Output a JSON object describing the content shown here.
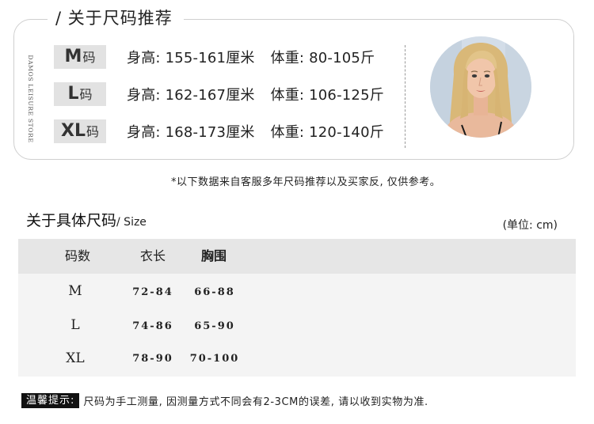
{
  "recommendation": {
    "title": "/ 关于尺码推荐",
    "brand_text": "DAMOS LEISURE STORE",
    "rows": [
      {
        "size": "M",
        "suffix": "码",
        "height_label": "身高:",
        "height": "155-161厘米",
        "weight_label": "体重:",
        "weight": "80-105斤"
      },
      {
        "size": "L",
        "suffix": "码",
        "height_label": "身高:",
        "height": "162-167厘米",
        "weight_label": "体重:",
        "weight": "106-125斤"
      },
      {
        "size": "XL",
        "suffix": "码",
        "height_label": "身高:",
        "height": "168-173厘米",
        "weight_label": "体重:",
        "weight": "120-140斤"
      }
    ]
  },
  "note": "*以下数据来自客服多年尺码推荐以及买家反, 仅供参考。",
  "specific": {
    "title": "关于具体尺码",
    "subtitle": "/ Size",
    "unit": "(单位: cm)",
    "headers": [
      "码数",
      "衣长",
      "胸围"
    ],
    "rows": [
      [
        "M",
        "72-84",
        "66-88"
      ],
      [
        "L",
        "74-86",
        "65-90"
      ],
      [
        "XL",
        "78-90",
        "70-100"
      ]
    ]
  },
  "tip": {
    "label": "温馨提示:",
    "text": "尺码为手工测量, 因测量方式不同会有2-3CM的误差, 请以收到实物为准."
  },
  "colors": {
    "badge_bg": "#e2e2e2",
    "table_header_bg": "#e6e6e6",
    "table_body_bg": "#f4f4f4",
    "tip_label_bg": "#111111"
  }
}
